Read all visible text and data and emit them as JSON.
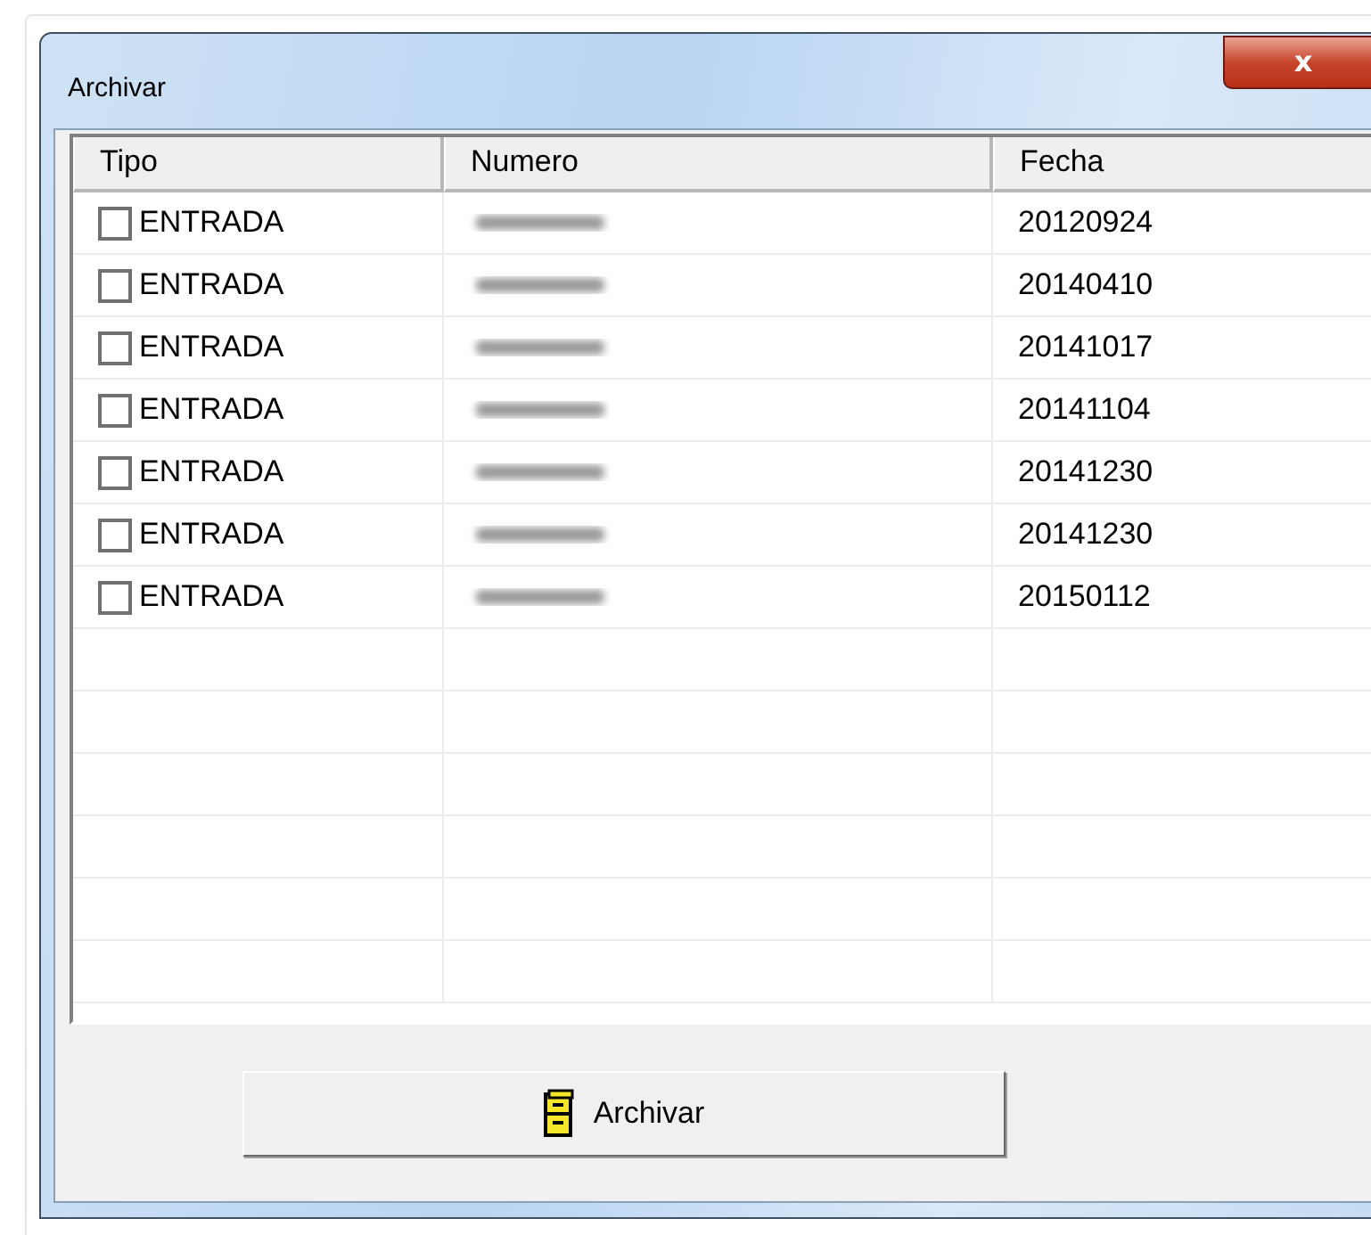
{
  "window": {
    "title": "Archivar",
    "close_label": "x"
  },
  "table": {
    "columns": [
      "Tipo",
      "Numero",
      "Fecha"
    ],
    "rows": [
      {
        "tipo": "ENTRADA",
        "checked": false,
        "fecha": "20120924"
      },
      {
        "tipo": "ENTRADA",
        "checked": false,
        "fecha": "20140410"
      },
      {
        "tipo": "ENTRADA",
        "checked": false,
        "fecha": "20141017"
      },
      {
        "tipo": "ENTRADA",
        "checked": false,
        "fecha": "20141104"
      },
      {
        "tipo": "ENTRADA",
        "checked": false,
        "fecha": "20141230"
      },
      {
        "tipo": "ENTRADA",
        "checked": false,
        "fecha": "20141230"
      },
      {
        "tipo": "ENTRADA",
        "checked": false,
        "fecha": "20150112"
      }
    ]
  },
  "button": {
    "label": "Archivar"
  }
}
